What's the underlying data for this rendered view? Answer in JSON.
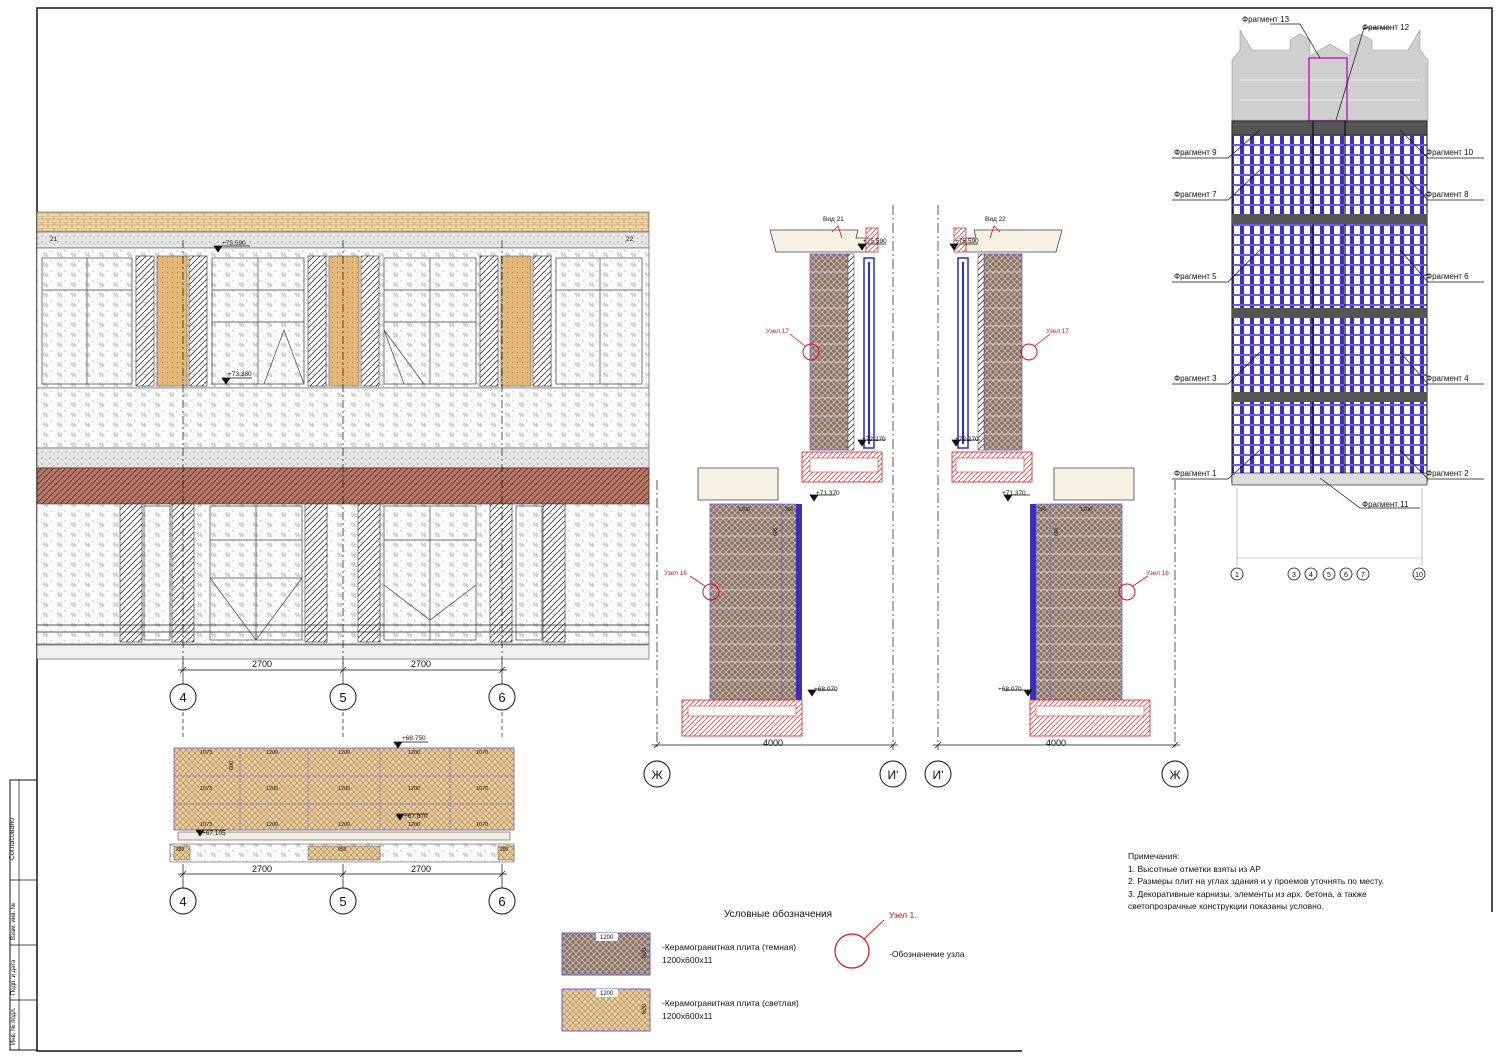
{
  "fragments": {
    "f13": "Фрагмент 13",
    "f12": "Фрагмент 12",
    "f9": "Фрагмент 9",
    "f10": "Фрагмент 10",
    "f7": "Фрагмент 7",
    "f8": "Фрагмент 8",
    "f5": "Фрагмент 5",
    "f6": "Фрагмент 6",
    "f3": "Фрагмент 3",
    "f4": "Фрагмент 4",
    "f1": "Фрагмент 1",
    "f2": "Фрагмент 2",
    "f11": "Фрагмент 11"
  },
  "mini_axes": [
    "1",
    "3",
    "4",
    "5",
    "6",
    "7",
    "10"
  ],
  "facade": {
    "axis_left": "21",
    "axis_right": "22",
    "mark_top": "+75.590",
    "mark_mid": "+73.380",
    "dim_1": "2700",
    "dim_2": "2700",
    "axes": [
      "4",
      "5",
      "6"
    ]
  },
  "plan": {
    "mark_a": "+68.750",
    "mark_b": "+67.870",
    "mark_c": "+67.105",
    "dim_1": "2700",
    "dim_2": "2700",
    "axes": [
      "4",
      "5",
      "6"
    ],
    "row1": [
      "1073",
      "1200",
      "1200",
      "1200",
      "1070"
    ],
    "row2": [
      "1073",
      "1200",
      "1200",
      "1200",
      "1070"
    ],
    "row3": [
      "1073",
      "1200",
      "1200",
      "1200",
      "1070"
    ],
    "v600": "600",
    "bottom": [
      "280",
      "950",
      "280"
    ]
  },
  "section_left": {
    "view": "Вид 21",
    "mark_top": "+75.590",
    "mark_mid": "+72.270",
    "mark_low": "+71.370",
    "mark_bot": "+68.070",
    "node_17": "Узел 17",
    "node_16": "Узел 16",
    "dim": "4000",
    "axis_a": "Ж",
    "axis_b": "И'"
  },
  "section_right": {
    "view": "Вид 22",
    "mark_top": "+75.590",
    "mark_mid": "+72.270",
    "mark_low": "+71.370",
    "mark_bot": "+68.070",
    "node_17": "Узел 17",
    "node_16": "Узел 16",
    "dim": "4000",
    "axis_a": "И'",
    "axis_b": "Ж"
  },
  "tile": {
    "w": "1200",
    "h": "600",
    "side": "266"
  },
  "notes": {
    "title": "Примечания:",
    "n1": "1. Высотные отметки взяты из АР",
    "n2": "2. Размеры плит на углах здания и у проемов уточнять по месту.",
    "n3": "3. Декоративные карнизы, элементы из арх. бетона, а также",
    "n3b": "светопрозрачные конструкции показаны условно."
  },
  "legend": {
    "title": "Условные обозначения",
    "dark_line1": "-Керамогранитная плита (темная)",
    "dark_line2": "1200х600х11",
    "light_line1": "-Керамогранитная плита (светлая)",
    "light_line2": "1200х600х11",
    "node_label": "Узел 1.",
    "node_text": "-Обозначение узла",
    "tile_w": "1200",
    "tile_h": "600"
  },
  "stamp": {
    "s1": "Согласовано",
    "s2": "Взам. инв. №",
    "s3": "Подп. и дата",
    "s4": "Инв. № подл."
  },
  "colors": {
    "dark_tile": "#8a7468",
    "light_tile": "#e2c79a",
    "window_blue": "#2c2cc8",
    "red": "#e01010",
    "magenta": "#c020c0"
  }
}
